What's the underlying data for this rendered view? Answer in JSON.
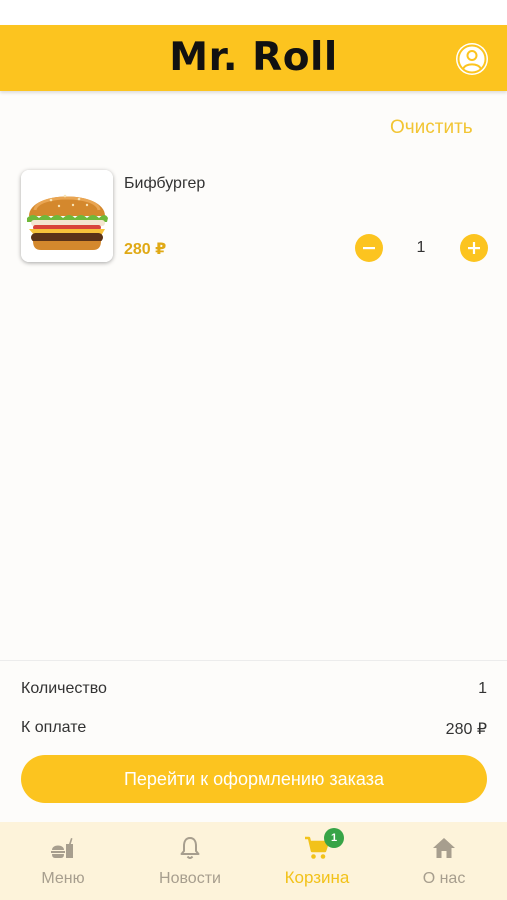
{
  "header": {
    "title": "Mr. Roll"
  },
  "cart": {
    "clear_label": "Очистить",
    "items": [
      {
        "name": "Бифбургер",
        "price": "280 ₽",
        "quantity": "1"
      }
    ]
  },
  "summary": {
    "quantity_label": "Количество",
    "quantity_value": "1",
    "total_label": "К оплате",
    "total_value": "280 ₽"
  },
  "checkout_label": "Перейти к оформлению заказа",
  "tabs": [
    {
      "label": "Меню",
      "icon": "food-icon"
    },
    {
      "label": "Новости",
      "icon": "bell-icon"
    },
    {
      "label": "Корзина",
      "icon": "cart-icon",
      "active": true,
      "badge": "1"
    },
    {
      "label": "О нас",
      "icon": "home-icon"
    }
  ],
  "colors": {
    "accent": "#fcc41f",
    "price": "#e0a915",
    "badge": "#37a447",
    "tabbar_bg": "#fdf3da",
    "tab_inactive": "#a79e8e"
  }
}
